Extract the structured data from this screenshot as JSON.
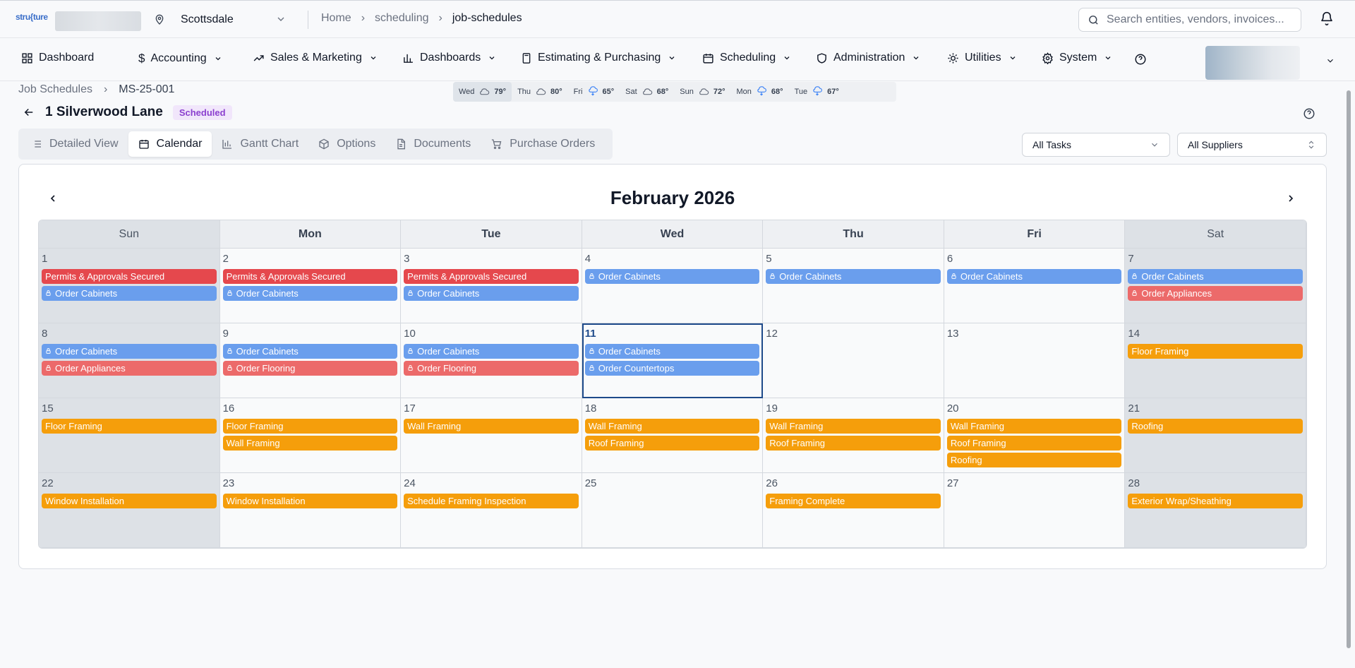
{
  "header": {
    "logo_text": "stru{ture",
    "location": "Scottsdale",
    "breadcrumbs": [
      "Home",
      "scheduling",
      "job-schedules"
    ],
    "search_placeholder": "Search entities, vendors, invoices..."
  },
  "nav": {
    "items": [
      {
        "label": "Dashboard",
        "icon": "grid-icon"
      },
      {
        "label": "Accounting",
        "icon": "dollar-icon"
      },
      {
        "label": "Sales & Marketing",
        "icon": "trending-icon"
      },
      {
        "label": "Dashboards",
        "icon": "bar-chart-icon"
      },
      {
        "label": "Estimating & Purchasing",
        "icon": "calculator-icon"
      },
      {
        "label": "Scheduling",
        "icon": "calendar-icon"
      },
      {
        "label": "Administration",
        "icon": "shield-icon"
      },
      {
        "label": "Utilities",
        "icon": "cog-icon"
      },
      {
        "label": "System",
        "icon": "gear-icon"
      }
    ]
  },
  "job": {
    "crumb_root": "Job Schedules",
    "crumb_id": "MS-25-001",
    "title": "1 Silverwood Lane",
    "status": "Scheduled"
  },
  "weather": [
    {
      "day": "Wed",
      "temp": "79°",
      "icon": "cloud-icon"
    },
    {
      "day": "Thu",
      "temp": "80°",
      "icon": "cloud-icon"
    },
    {
      "day": "Fri",
      "temp": "65°",
      "icon": "cloud-rain-icon"
    },
    {
      "day": "Sat",
      "temp": "68°",
      "icon": "cloud-icon"
    },
    {
      "day": "Sun",
      "temp": "72°",
      "icon": "cloud-icon"
    },
    {
      "day": "Mon",
      "temp": "68°",
      "icon": "cloud-rain-icon"
    },
    {
      "day": "Tue",
      "temp": "67°",
      "icon": "cloud-rain-icon"
    }
  ],
  "tabs": [
    {
      "label": "Detailed View",
      "icon": "list-icon"
    },
    {
      "label": "Calendar",
      "icon": "calendar-icon"
    },
    {
      "label": "Gantt Chart",
      "icon": "chart-icon"
    },
    {
      "label": "Options",
      "icon": "box-icon"
    },
    {
      "label": "Documents",
      "icon": "document-icon"
    },
    {
      "label": "Purchase Orders",
      "icon": "cart-icon"
    }
  ],
  "filters": {
    "tasks": "All Tasks",
    "suppliers": "All Suppliers"
  },
  "calendar": {
    "month_label": "February 2026",
    "weekdays": [
      "Sun",
      "Mon",
      "Tue",
      "Wed",
      "Thu",
      "Fri",
      "Sat"
    ],
    "today": 11,
    "days": [
      {
        "n": "1",
        "events": [
          {
            "t": "Permits & Approvals Secured",
            "c": "red"
          },
          {
            "t": "Order Cabinets",
            "c": "blue",
            "lock": true
          }
        ]
      },
      {
        "n": "2",
        "events": [
          {
            "t": "Permits & Approvals Secured",
            "c": "red"
          },
          {
            "t": "Order Cabinets",
            "c": "blue",
            "lock": true
          }
        ]
      },
      {
        "n": "3",
        "events": [
          {
            "t": "Permits & Approvals Secured",
            "c": "red"
          },
          {
            "t": "Order Cabinets",
            "c": "blue",
            "lock": true
          }
        ]
      },
      {
        "n": "4",
        "events": [
          {
            "t": "Order Cabinets",
            "c": "blue",
            "lock": true
          }
        ]
      },
      {
        "n": "5",
        "events": [
          {
            "t": "Order Cabinets",
            "c": "blue",
            "lock": true
          }
        ]
      },
      {
        "n": "6",
        "events": [
          {
            "t": "Order Cabinets",
            "c": "blue",
            "lock": true
          }
        ]
      },
      {
        "n": "7",
        "events": [
          {
            "t": "Order Cabinets",
            "c": "blue",
            "lock": true
          },
          {
            "t": "Order Appliances",
            "c": "salmon",
            "lock": true
          }
        ]
      },
      {
        "n": "8",
        "events": [
          {
            "t": "Order Cabinets",
            "c": "blue",
            "lock": true
          },
          {
            "t": "Order Appliances",
            "c": "salmon",
            "lock": true
          }
        ]
      },
      {
        "n": "9",
        "events": [
          {
            "t": "Order Cabinets",
            "c": "blue",
            "lock": true
          },
          {
            "t": "Order Flooring",
            "c": "salmon",
            "lock": true
          }
        ]
      },
      {
        "n": "10",
        "events": [
          {
            "t": "Order Cabinets",
            "c": "blue",
            "lock": true
          },
          {
            "t": "Order Flooring",
            "c": "salmon",
            "lock": true
          }
        ]
      },
      {
        "n": "11",
        "events": [
          {
            "t": "Order Cabinets",
            "c": "blue",
            "lock": true
          },
          {
            "t": "Order Countertops",
            "c": "blue",
            "lock": true
          }
        ]
      },
      {
        "n": "12",
        "events": []
      },
      {
        "n": "13",
        "events": []
      },
      {
        "n": "14",
        "events": [
          {
            "t": "Floor Framing",
            "c": "orange"
          }
        ]
      },
      {
        "n": "15",
        "events": [
          {
            "t": "Floor Framing",
            "c": "orange"
          }
        ]
      },
      {
        "n": "16",
        "events": [
          {
            "t": "Floor Framing",
            "c": "orange"
          },
          {
            "t": "Wall Framing",
            "c": "orange"
          }
        ]
      },
      {
        "n": "17",
        "events": [
          {
            "t": "Wall Framing",
            "c": "orange"
          }
        ]
      },
      {
        "n": "18",
        "events": [
          {
            "t": "Wall Framing",
            "c": "orange"
          },
          {
            "t": "Roof Framing",
            "c": "orange"
          }
        ]
      },
      {
        "n": "19",
        "events": [
          {
            "t": "Wall Framing",
            "c": "orange"
          },
          {
            "t": "Roof Framing",
            "c": "orange"
          }
        ]
      },
      {
        "n": "20",
        "events": [
          {
            "t": "Wall Framing",
            "c": "orange"
          },
          {
            "t": "Roof Framing",
            "c": "orange"
          },
          {
            "t": "Roofing",
            "c": "orange"
          }
        ]
      },
      {
        "n": "21",
        "events": [
          {
            "t": "Roofing",
            "c": "orange"
          }
        ]
      },
      {
        "n": "22",
        "events": [
          {
            "t": "Window Installation",
            "c": "orange"
          }
        ]
      },
      {
        "n": "23",
        "events": [
          {
            "t": "Window Installation",
            "c": "orange"
          }
        ]
      },
      {
        "n": "24",
        "events": [
          {
            "t": "Schedule Framing Inspection",
            "c": "orange"
          }
        ]
      },
      {
        "n": "25",
        "events": []
      },
      {
        "n": "26",
        "events": [
          {
            "t": "Framing Complete",
            "c": "orange"
          }
        ]
      },
      {
        "n": "27",
        "events": []
      },
      {
        "n": "28",
        "events": [
          {
            "t": "Exterior Wrap/Sheathing",
            "c": "orange"
          }
        ]
      }
    ]
  },
  "colors": {
    "red": "#e5484d",
    "salmon": "#ec6a6a",
    "blue": "#6a9eed",
    "orange": "#f59e0b",
    "status_badge": "#8b3fcf",
    "today_border": "#1e4a8a"
  }
}
